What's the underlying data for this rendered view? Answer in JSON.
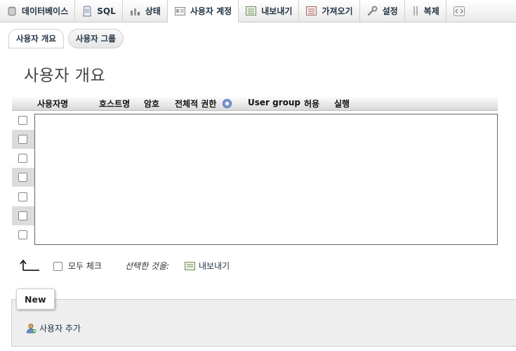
{
  "tabs": [
    {
      "label": "데이터베이스",
      "icon": "database-icon",
      "active": false
    },
    {
      "label": "SQL",
      "icon": "sql-icon",
      "active": false
    },
    {
      "label": "상태",
      "icon": "status-icon",
      "active": false
    },
    {
      "label": "사용자 계정",
      "icon": "user-accounts-icon",
      "active": true
    },
    {
      "label": "내보내기",
      "icon": "export-icon",
      "active": false
    },
    {
      "label": "가져오기",
      "icon": "import-icon",
      "active": false
    },
    {
      "label": "설정",
      "icon": "settings-wrench-icon",
      "active": false
    },
    {
      "label": "복제",
      "icon": "replication-icon",
      "active": false
    }
  ],
  "subtabs": {
    "overview": "사용자 개요",
    "groups": "사용자 그룹"
  },
  "page_title": "사용자 개요",
  "table": {
    "headers": {
      "username": "사용자명",
      "host": "호스트명",
      "password": "암호",
      "global_privileges": "전체적 권한",
      "user_group": "User group",
      "grant": "허용",
      "action": "실행"
    },
    "row_count": 7
  },
  "bulk": {
    "check_all": "모두 체크",
    "with_selected": "선택한 것을:",
    "export": "내보내기"
  },
  "new_section": {
    "legend": "New",
    "add_user": "사용자 추가"
  }
}
